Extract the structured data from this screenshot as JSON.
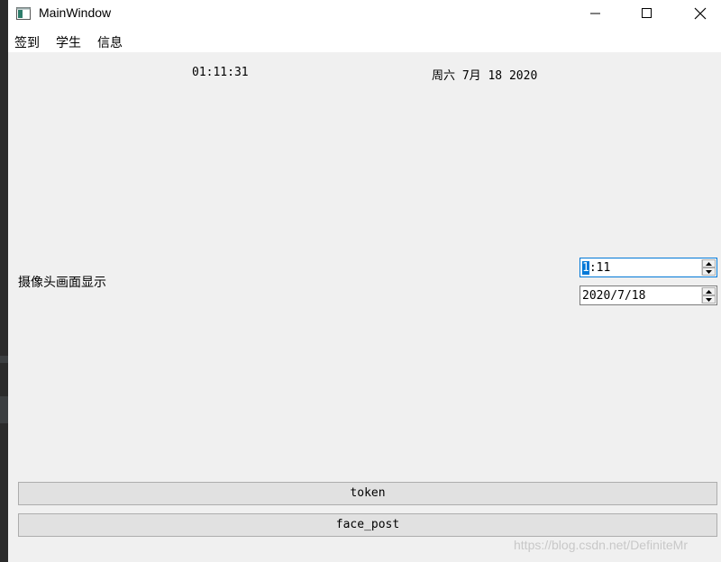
{
  "window": {
    "title": "MainWindow"
  },
  "menu": {
    "items": [
      "签到",
      "学生",
      "信息"
    ]
  },
  "clock": {
    "time": "01:11:31",
    "date": "周六 7月 18 2020"
  },
  "camera": {
    "label": "摄像头画面显示"
  },
  "time_edit": {
    "selected": "1",
    "rest": ":11"
  },
  "date_edit": {
    "value": "2020/7/18"
  },
  "buttons": {
    "token": "token",
    "face_post": "face_post"
  },
  "watermark": "https://blog.csdn.net/DefiniteMr",
  "colors": {
    "window_bg": "#f0f0f0",
    "accent": "#0078d7",
    "button_bg": "#e1e1e1"
  },
  "icons": [
    "app-icon",
    "minimize-icon",
    "maximize-icon",
    "close-icon",
    "spin-up-icon",
    "spin-down-icon"
  ]
}
